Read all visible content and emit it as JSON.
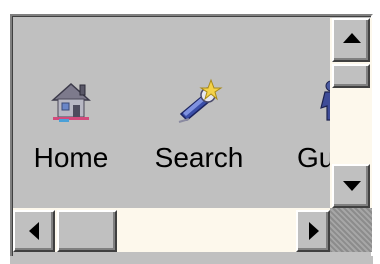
{
  "toolbar": {
    "items": [
      {
        "label": "Home",
        "icon": "home-icon"
      },
      {
        "label": "Search",
        "icon": "search-icon"
      },
      {
        "label": "Gu",
        "icon": "guide-icon"
      }
    ]
  },
  "scrollbars": {
    "vertical": {
      "thumb_position": 0.0
    },
    "horizontal": {
      "thumb_position": 0.0
    }
  },
  "colors": {
    "face": "#c0c0c0",
    "track": "#fdf8ec",
    "highlight": "#ffffff",
    "shadow": "#808080",
    "dark": "#404040"
  }
}
